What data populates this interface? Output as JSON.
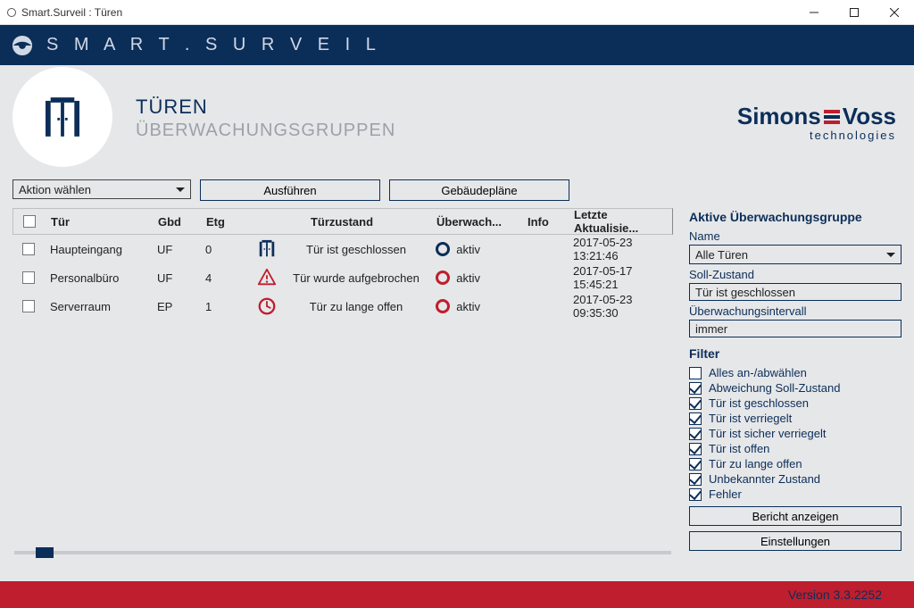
{
  "window": {
    "title": "Smart.Surveil : Türen"
  },
  "brand": {
    "name": "S M A R T . S U R V E I L"
  },
  "page": {
    "title": "TÜREN",
    "subtitle": "ÜBERWACHUNGSGRUPPEN"
  },
  "logo": {
    "line1a": "Simons",
    "line1b": "Voss",
    "line2": "technologies"
  },
  "toolbar": {
    "action_select": "Aktion wählen",
    "execute_btn": "Ausführen",
    "plans_btn": "Gebäudepläne"
  },
  "table": {
    "headers": {
      "tur": "Tür",
      "gbd": "Gbd",
      "etg": "Etg",
      "state": "Türzustand",
      "mon": "Überwach...",
      "info": "Info",
      "update": "Letzte Aktualisie..."
    },
    "rows": [
      {
        "tur": "Haupteingang",
        "gbd": "UF",
        "etg": "0",
        "state_icon": "door-closed",
        "state": "Tür ist geschlossen",
        "mon_icon": "navy",
        "mon": "aktiv",
        "update": "2017-05-23 13:21:46"
      },
      {
        "tur": "Personalbüro",
        "gbd": "UF",
        "etg": "4",
        "state_icon": "alert",
        "state": "Tür wurde aufgebrochen",
        "mon_icon": "red",
        "mon": "aktiv",
        "update": "2017-05-17 15:45:21"
      },
      {
        "tur": "Serverraum",
        "gbd": "EP",
        "etg": "1",
        "state_icon": "clock",
        "state": "Tür zu lange offen",
        "mon_icon": "red",
        "mon": "aktiv",
        "update": "2017-05-23 09:35:30"
      }
    ]
  },
  "right": {
    "heading": "Aktive Überwachungsgruppe",
    "name_label": "Name",
    "name_value": "Alle Türen",
    "soll_label": "Soll-Zustand",
    "soll_value": "Tür ist geschlossen",
    "interval_label": "Überwachungsintervall",
    "interval_value": "immer",
    "filter_heading": "Filter",
    "filters": [
      {
        "label": "Alles an-/abwählen",
        "checked": false
      },
      {
        "label": "Abweichung Soll-Zustand",
        "checked": true
      },
      {
        "label": "Tür ist geschlossen",
        "checked": true
      },
      {
        "label": "Tür ist verriegelt",
        "checked": true
      },
      {
        "label": "Tür ist sicher verriegelt",
        "checked": true
      },
      {
        "label": "Tür ist offen",
        "checked": true
      },
      {
        "label": "Tür zu lange offen",
        "checked": true
      },
      {
        "label": "Unbekannter Zustand",
        "checked": true
      },
      {
        "label": "Fehler",
        "checked": true
      }
    ],
    "report_btn": "Bericht anzeigen",
    "settings_btn": "Einstellungen"
  },
  "footer": {
    "version": "Version 3.3.2252"
  }
}
